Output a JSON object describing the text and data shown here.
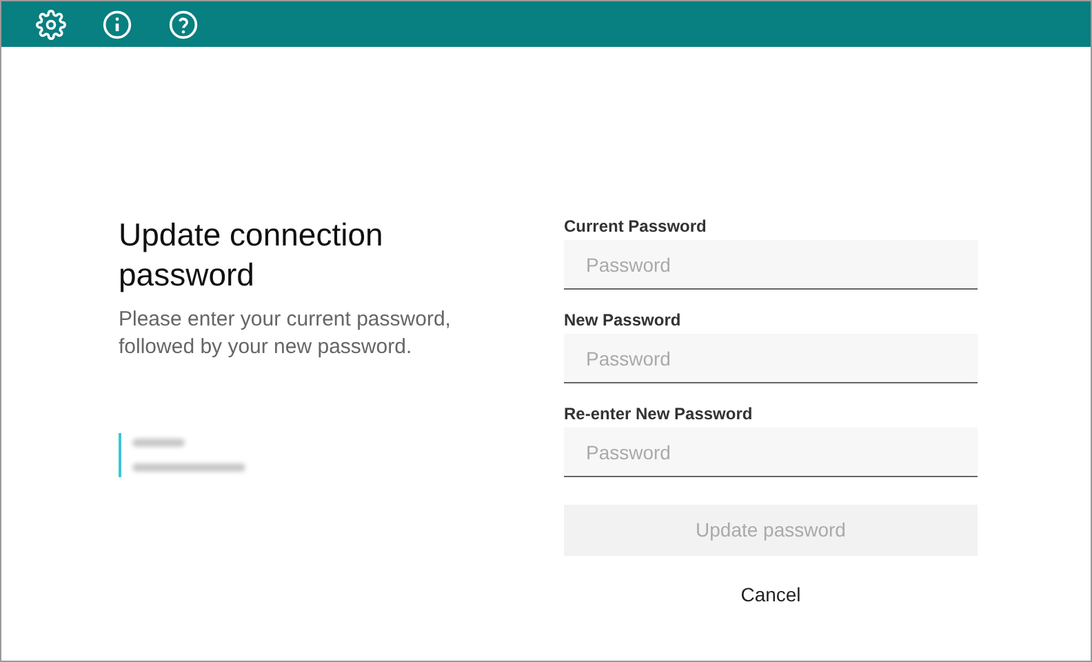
{
  "toolbar": {
    "icons": [
      {
        "kind": "settings"
      },
      {
        "kind": "info"
      },
      {
        "kind": "help"
      }
    ]
  },
  "intro": {
    "title": "Update connection password",
    "description": "Please enter your current password, followed by your new password."
  },
  "fields": [
    {
      "label": "Current Password",
      "placeholder": "Password"
    },
    {
      "label": "New Password",
      "placeholder": "Password"
    },
    {
      "label": "Re-enter New Password",
      "placeholder": "Password"
    }
  ],
  "submit": {
    "label": "Update password",
    "disabled": true
  },
  "cancel": {
    "label": "Cancel"
  }
}
